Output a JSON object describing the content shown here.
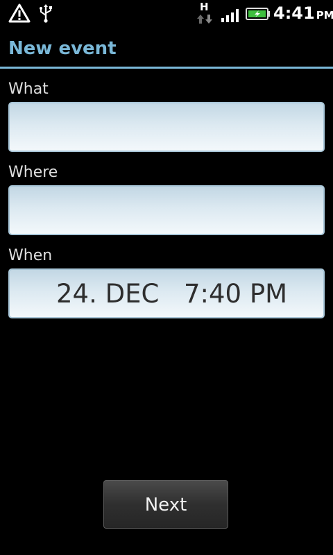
{
  "status_bar": {
    "time": "4:41",
    "ampm": "PM",
    "data_type": "H",
    "icons": [
      "warning-icon",
      "usb-icon",
      "data-activity-icon",
      "signal-icon",
      "battery-charging-icon"
    ],
    "battery_color": "#3fbf3f"
  },
  "header": {
    "title": "New event",
    "accent_color": "#7ab8d8"
  },
  "form": {
    "what": {
      "label": "What",
      "value": ""
    },
    "where": {
      "label": "Where",
      "value": ""
    },
    "when": {
      "label": "When",
      "date": "24. DEC",
      "time": "7:40 PM"
    }
  },
  "actions": {
    "next_label": "Next"
  }
}
